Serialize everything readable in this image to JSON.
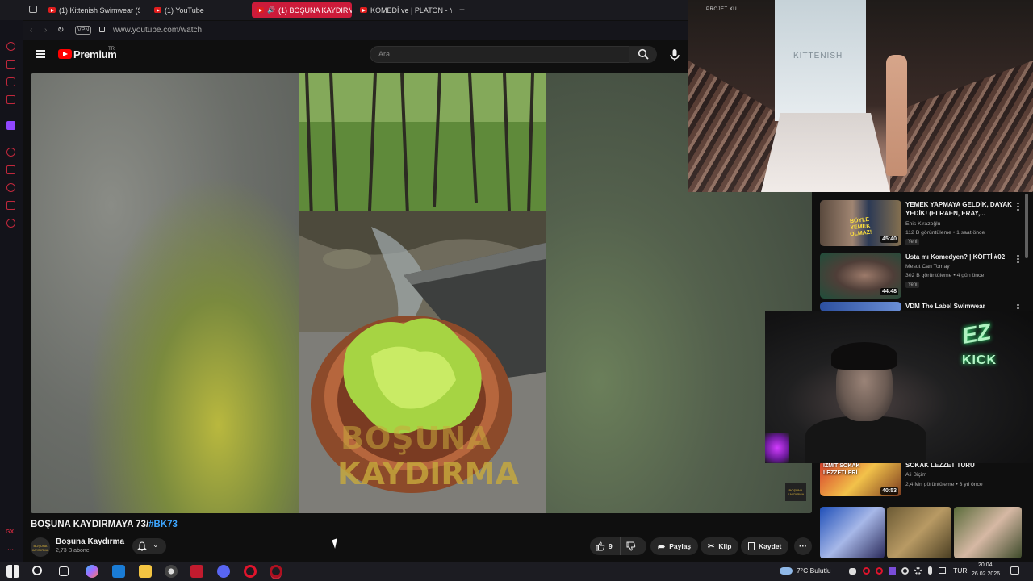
{
  "tabs": [
    {
      "label": "(1) Kittenish Swimwear (St"
    },
    {
      "label": "(1) YouTube"
    },
    {
      "label": "(1) BOŞUNA KAYDIRM"
    },
    {
      "label": "KOMEDİ ve | PLATON - Yo"
    }
  ],
  "address": {
    "vpn": "VPN",
    "url": "www.youtube.com/watch"
  },
  "header": {
    "logo": "Premium",
    "region": "TR",
    "search_placeholder": "Ara"
  },
  "video": {
    "watermark_line1": "BOŞUNA",
    "watermark_line2": "KAYDIRMA",
    "channel_badge": "BOŞUNA KAYDIRMA",
    "title_text": "BOŞUNA KAYDIRMAYA 73/",
    "hashtag": "#BK73",
    "channel_name": "Boşuna Kaydırma",
    "subscribers": "2,73 B abone",
    "likes": "9",
    "share": "Paylaş",
    "clip": "Klip",
    "save": "Kaydet"
  },
  "stream_top": {
    "brand": "KITTENISH",
    "overlay_text": "PROJET XU"
  },
  "recommendations": [
    {
      "title": "YEMEK YAPMAYA GELDİK, DAYAK YEDİK! (ELRAEN, ERAY,...",
      "channel": "Enis Kirazoğlu",
      "meta": "112 B görüntüleme • 1 saat önce",
      "badge": "Yeni",
      "duration": "45:40",
      "thumb_text": "BÖYLE YEMEK OLMAZ!"
    },
    {
      "title": "Usta mı Komedyen? | KÖFTİ #02",
      "channel": "Mesut Can Tomay",
      "meta": "302 B görüntüleme • 4 gün önce",
      "badge": "Yeni",
      "duration": "44:48",
      "thumb_text": ""
    },
    {
      "title": "VDM The Label Swimwear",
      "channel": "",
      "meta": "",
      "badge": "",
      "duration": "",
      "thumb_text": ""
    },
    {
      "title": "SOKAK LEZZET TURU",
      "channel": "Ali Biçim",
      "meta": "2,4 Mn görüntüleme • 3 yıl önce",
      "badge": "",
      "duration": "40:53",
      "thumb_text": "İZMİT SOKAK LEZZETLERİ"
    }
  ],
  "overlay_cam": {
    "ez": "EZ",
    "kick": "KICK"
  },
  "taskbar": {
    "weather": "7°C  Bulutlu",
    "lang": "TUR",
    "time": "20:04",
    "date": "26.02.2026"
  },
  "colors": {
    "accent": "#cc1b3a",
    "yt_red": "#ff0000",
    "link": "#3ea6ff"
  }
}
